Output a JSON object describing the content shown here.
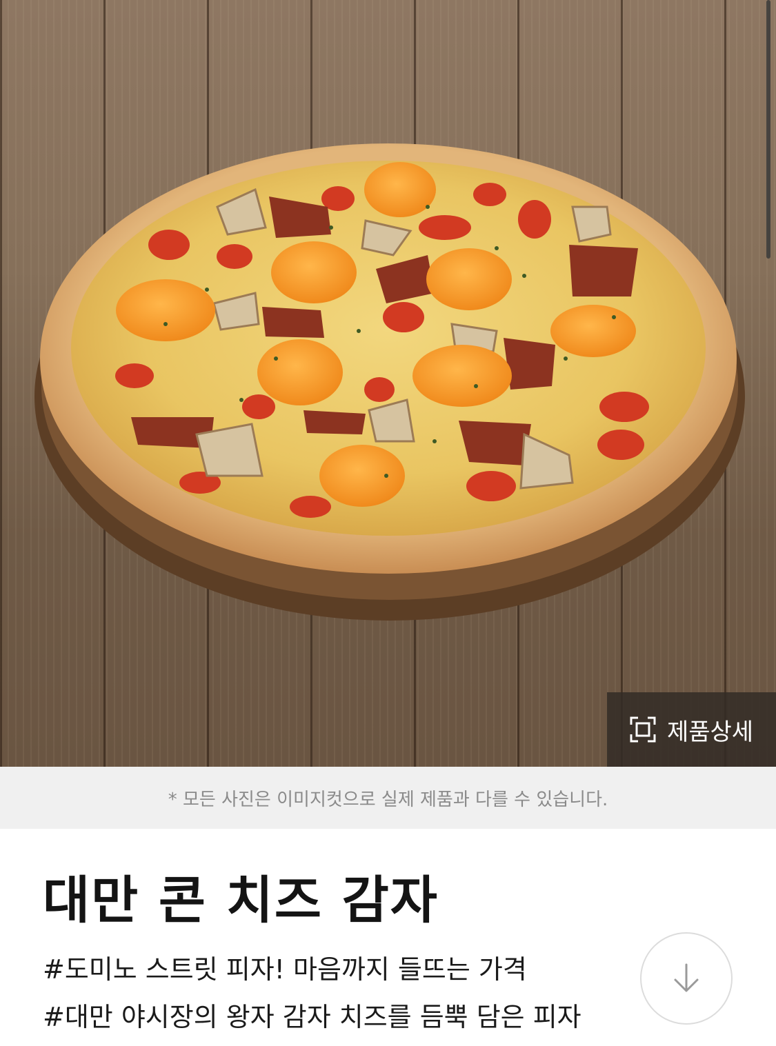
{
  "hero": {
    "image_alt": "Pizza photo",
    "detail_button_label": "제품상세",
    "detail_icon": "focus-frame-icon"
  },
  "disclaimer": "* 모든 사진은 이미지컷으로 실제 제품과 다를 수 있습니다.",
  "product": {
    "title": "대만 콘 치즈 감자",
    "tags": [
      "#도미노 스트릿 피자! 마음까지 들뜨는 가격",
      "#대만 야시장의 왕자 감자 치즈를 듬뿍 담은 피자"
    ]
  },
  "download_button": {
    "icon": "arrow-down-icon"
  },
  "colors": {
    "disclaimer_bg": "#f0f0f0",
    "title_text": "#141414",
    "detail_button_bg": "#322c26"
  }
}
